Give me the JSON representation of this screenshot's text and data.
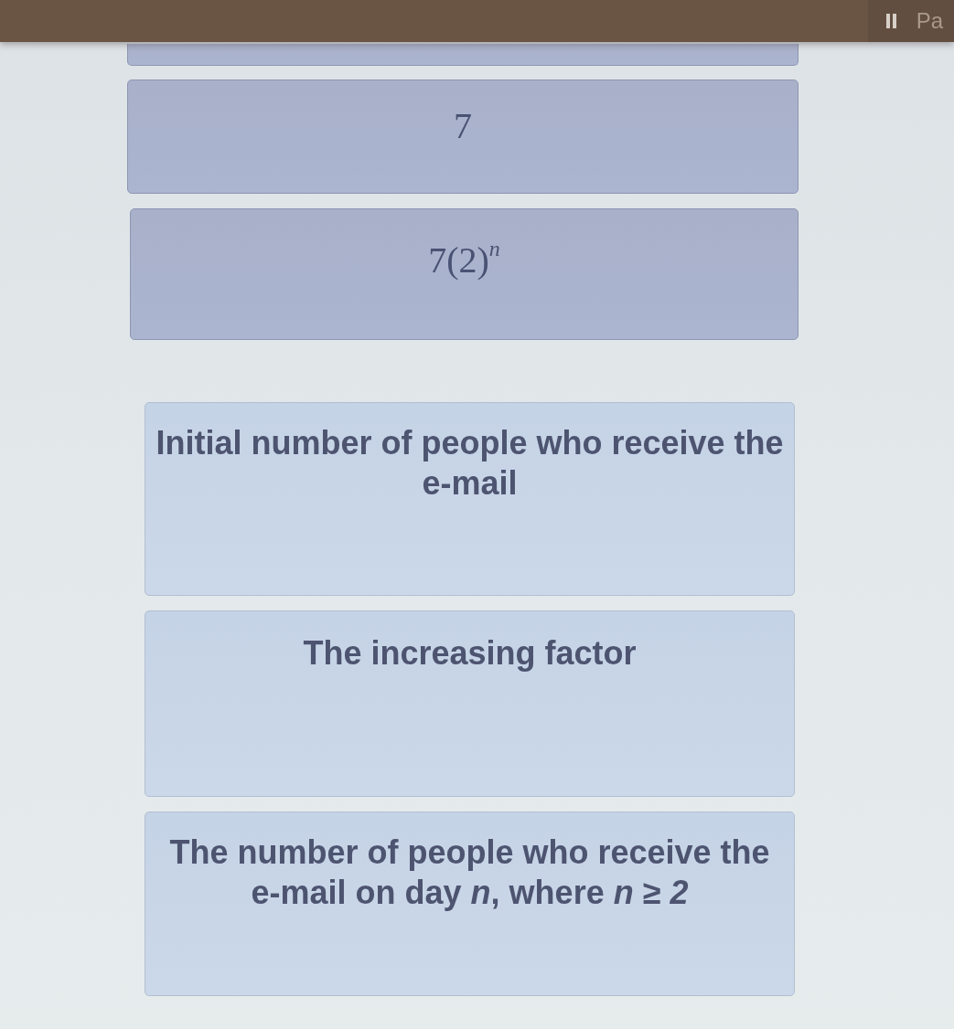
{
  "top_bar": {
    "pause_button": {
      "label": "Pa"
    }
  },
  "expression_cards": {
    "cut_off_above": true,
    "cards": [
      {
        "kind": "math",
        "text": "7"
      },
      {
        "kind": "math",
        "text": "7(2)$^{n}$"
      }
    ]
  },
  "description_cards": [
    {
      "kind": "text",
      "text": "Initial number of people who receive the e-mail"
    },
    {
      "kind": "text",
      "text": "The increasing factor"
    },
    {
      "kind": "text",
      "text": "The number of people who receive the e-mail on day *n*, where *n* ≥ *2*"
    }
  ]
}
